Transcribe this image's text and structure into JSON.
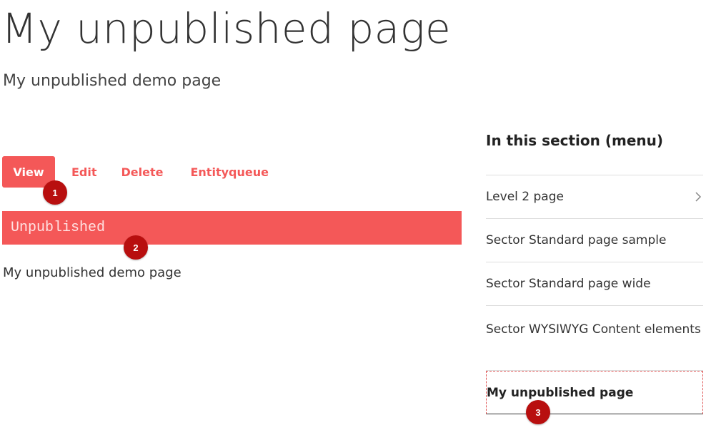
{
  "page": {
    "title": "My unpublished page",
    "subtitle": "My unpublished demo page",
    "body_text": "My unpublished demo page"
  },
  "tabs": [
    {
      "label": "View",
      "active": true
    },
    {
      "label": "Edit",
      "active": false
    },
    {
      "label": "Delete",
      "active": false
    },
    {
      "label": "Entityqueue",
      "active": false
    }
  ],
  "status": {
    "label": "Unpublished"
  },
  "section_menu": {
    "heading": "In this section (menu)",
    "items": [
      {
        "label": "Level 2 page",
        "has_children": true,
        "icon": "chevron-right-icon"
      },
      {
        "label": "Sector Standard page sample"
      },
      {
        "label": "Sector Standard page wide"
      },
      {
        "label": "Sector WYSIWYG Content elements"
      },
      {
        "label": "My unpublished page",
        "current": true
      }
    ]
  },
  "badges": [
    "1",
    "2",
    "3"
  ],
  "colors": {
    "accent": "#f45858",
    "badge": "#b80f0f",
    "text": "#333333",
    "divider": "#dddddd"
  }
}
